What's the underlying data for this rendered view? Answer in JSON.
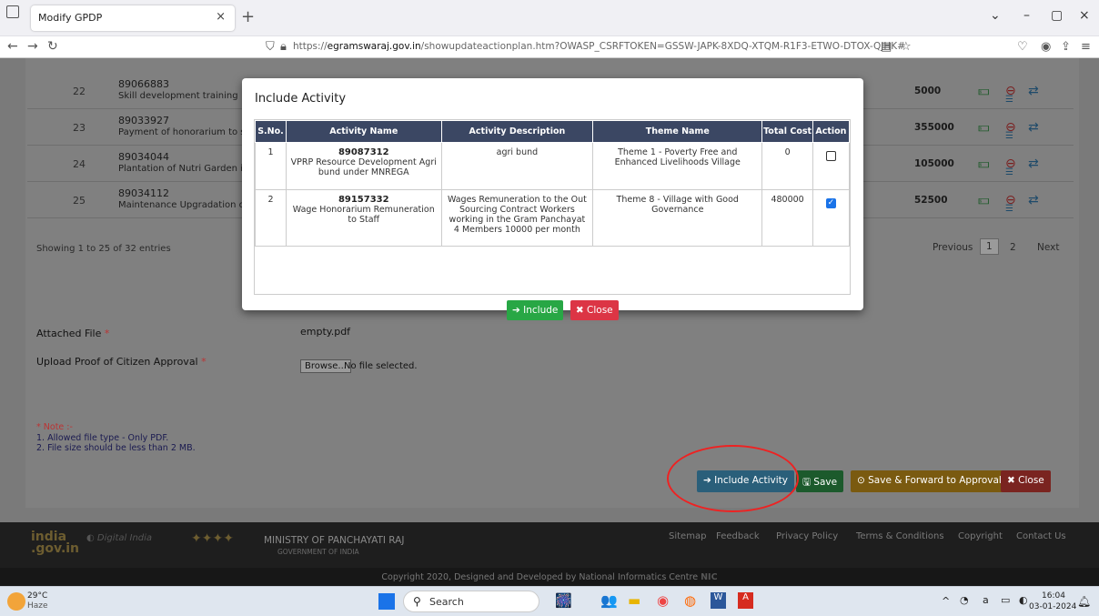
{
  "browser": {
    "tab_title": "Modify GPDP",
    "url_prefix": "https://",
    "url_domain": "egramswaraj.gov.in",
    "url_rest": "/showupdateactionplan.htm?OWASP_CSRFTOKEN=GSSW-JAPK-8XDQ-XTQM-R1F3-ETWO-DTOX-QJHK#"
  },
  "rows": [
    {
      "sno": "22",
      "id": "89066883",
      "desc": "Skill development training",
      "amount": "5000"
    },
    {
      "sno": "23",
      "id": "89033927",
      "desc": "Payment of honorarium to swe",
      "amount": "355000"
    },
    {
      "sno": "24",
      "id": "89034044",
      "desc": "Plantation of Nutri Garden in A",
      "amount": "105000"
    },
    {
      "sno": "25",
      "id": "89034112",
      "desc": "Maintenance Upgradation of C",
      "amount": "52500"
    }
  ],
  "table_info": "Showing 1 to 25 of 32 entries",
  "pager": {
    "previous": "Previous",
    "page1": "1",
    "page2": "2",
    "next": "Next"
  },
  "form": {
    "attached_label": "Attached File",
    "attached_value": "empty.pdf",
    "upload_label": "Upload Proof of Citizen Approval",
    "browse": "Browse...",
    "no_file": "No file selected.",
    "note_title": "* Note :-",
    "note1": "1. Allowed file type - Only PDF.",
    "note2": "2. File size should be less than 2 MB."
  },
  "actions": {
    "include": "Include Activity",
    "save": "Save",
    "forward": "Save & Forward to Approval",
    "close": "Close"
  },
  "footer": {
    "ministry": "MINISTRY OF PANCHAYATI RAJ",
    "gov": "GOVERNMENT OF INDIA",
    "links": [
      "Sitemap",
      "Feedback",
      "Privacy Policy",
      "Terms & Conditions",
      "Copyright",
      "Contact Us"
    ],
    "copyright": "Copyright 2020, Designed and Developed by National Informatics Centre"
  },
  "modal": {
    "title": "Include Activity",
    "headers": [
      "S.No.",
      "Activity Name",
      "Activity Description",
      "Theme Name",
      "Total Cost",
      "Action"
    ],
    "rows": [
      {
        "sno": "1",
        "code": "89087312",
        "name": "VPRP Resource Development Agri bund under MNREGA",
        "desc": "agri bund",
        "theme": "Theme 1 - Poverty Free and Enhanced Livelihoods Village",
        "cost": "0",
        "checked": false
      },
      {
        "sno": "2",
        "code": "89157332",
        "name": "Wage Honorarium Remuneration to Staff",
        "desc": "Wages Remuneration to the Out Sourcing Contract Workers working in the Gram Panchayat 4 Members 10000 per month",
        "theme": "Theme 8 - Village with Good Governance",
        "cost": "480000",
        "checked": true
      }
    ],
    "include_btn": "Include",
    "close_btn": "Close"
  },
  "taskbar": {
    "temp": "29°C",
    "weather": "Haze",
    "search": "Search",
    "time": "16:04",
    "date": "03-01-2024",
    "badge": "1"
  },
  "colors": {
    "accent": "#1a73e8",
    "include_green": "#28a745",
    "close_red": "#dc3545",
    "header_navy": "#3b4763"
  }
}
